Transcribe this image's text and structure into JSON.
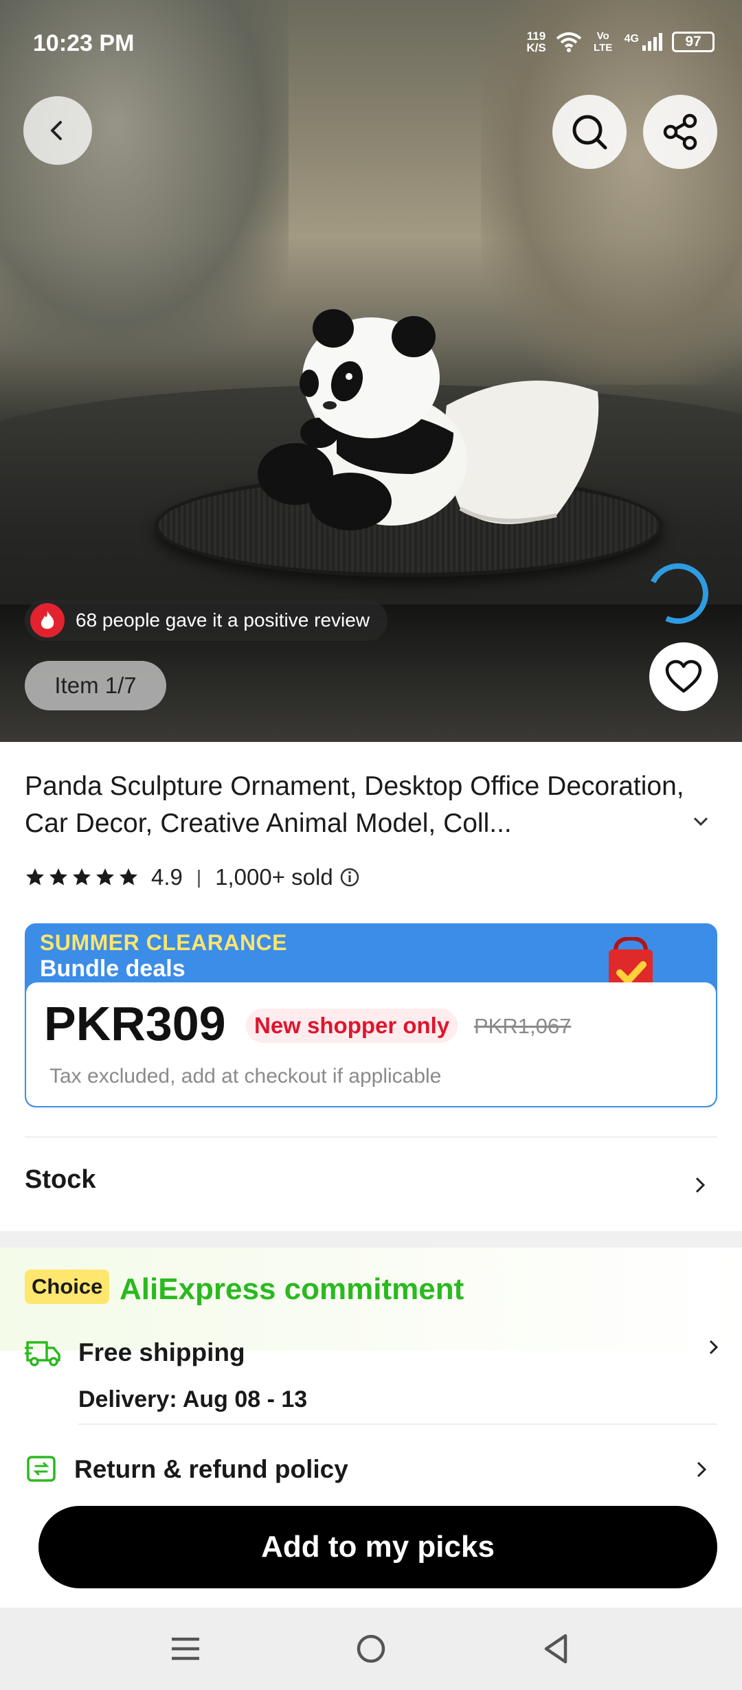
{
  "status_bar": {
    "time": "10:23 PM",
    "net_speed_value": "119",
    "net_speed_unit": "K/S",
    "volte": "Vo LTE",
    "network": "4G",
    "battery": "97"
  },
  "hero": {
    "review_text": "68 people gave it a positive review",
    "item_counter": "Item 1/7",
    "icons": [
      "back-arrow-icon",
      "search-icon",
      "share-icon",
      "heart-icon",
      "fire-icon"
    ]
  },
  "product": {
    "title": "Panda Sculpture Ornament, Desktop Office Decoration, Car Decor, Creative Animal Model, Coll...",
    "rating": "4.9",
    "rating_stars": 5,
    "sold": "1,000+ sold"
  },
  "promo": {
    "banner_line1": "SUMMER CLEARANCE",
    "banner_line2": "Bundle deals",
    "price": "PKR309",
    "badge": "New shopper only",
    "old_price": "PKR1,067",
    "tax_note": "Tax excluded, add at checkout if applicable"
  },
  "stock": {
    "label": "Stock"
  },
  "commitment": {
    "choice_label": "Choice",
    "title": "AliExpress commitment",
    "shipping_title": "Free shipping",
    "delivery": "Delivery: Aug 08 - 13",
    "return_title": "Return & refund policy"
  },
  "cta": {
    "label": "Add to my picks"
  },
  "colors": {
    "accent_blue": "#3c8de8",
    "badge_red": "#e0142d",
    "commit_green": "#2ab91f",
    "choice_yellow": "#ffe66e"
  }
}
